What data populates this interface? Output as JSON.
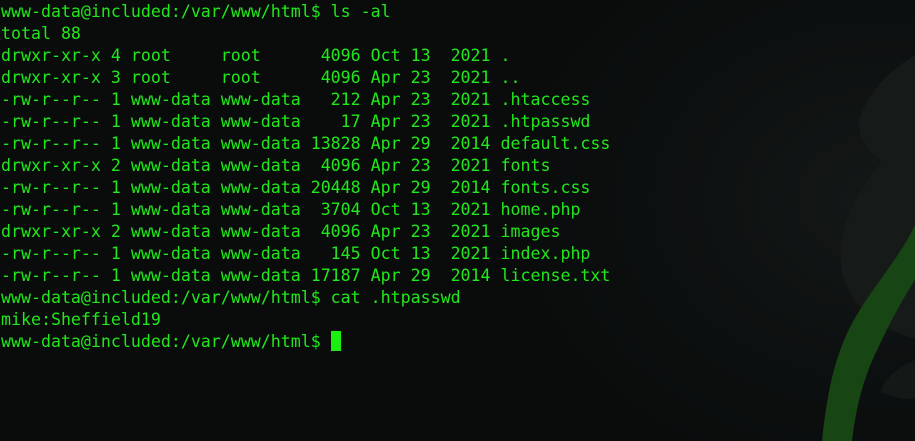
{
  "terminal": {
    "lines": [
      "www-data@included:/var/www/html$ ls -al",
      "total 88",
      "drwxr-xr-x 4 root     root      4096 Oct 13  2021 .",
      "drwxr-xr-x 3 root     root      4096 Apr 23  2021 ..",
      "-rw-r--r-- 1 www-data www-data   212 Apr 23  2021 .htaccess",
      "-rw-r--r-- 1 www-data www-data    17 Apr 23  2021 .htpasswd",
      "-rw-r--r-- 1 www-data www-data 13828 Apr 29  2014 default.css",
      "drwxr-xr-x 2 www-data www-data  4096 Apr 23  2021 fonts",
      "-rw-r--r-- 1 www-data www-data 20448 Apr 29  2014 fonts.css",
      "-rw-r--r-- 1 www-data www-data  3704 Oct 13  2021 home.php",
      "drwxr-xr-x 2 www-data www-data  4096 Apr 23  2021 images",
      "-rw-r--r-- 1 www-data www-data   145 Oct 13  2021 index.php",
      "-rw-r--r-- 1 www-data www-data 17187 Apr 29  2014 license.txt",
      "www-data@included:/var/www/html$ cat .htpasswd",
      "mike:Sheffield19"
    ],
    "prompt": "www-data@included:/var/www/html$",
    "colors": {
      "background": "#0a0c0c",
      "text": "#21e81b",
      "cursor": "#1af00f"
    }
  }
}
